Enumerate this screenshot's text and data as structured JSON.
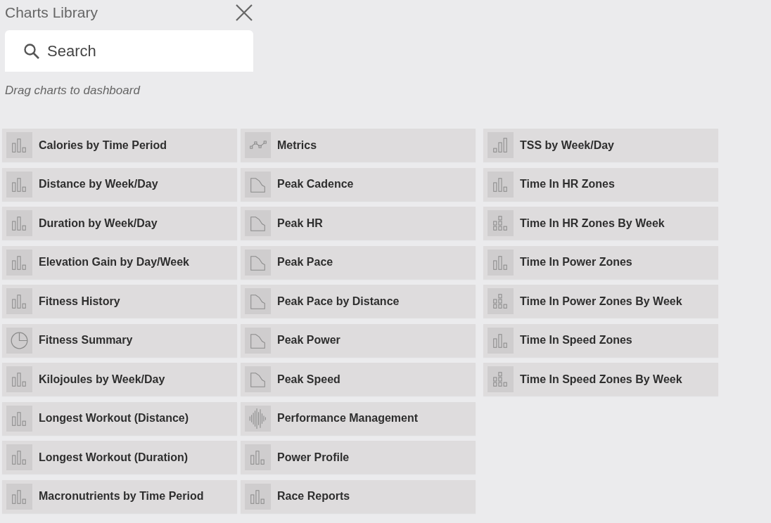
{
  "panel": {
    "title": "Charts Library"
  },
  "search": {
    "placeholder": "Search"
  },
  "hint": "Drag charts to dashboard",
  "columns": [
    [
      {
        "label": "Calories by Time Period",
        "kind": "bar"
      },
      {
        "label": "Distance by Week/Day",
        "kind": "bar"
      },
      {
        "label": "Duration by Week/Day",
        "kind": "bar"
      },
      {
        "label": "Elevation Gain by Day/Week",
        "kind": "bar"
      },
      {
        "label": "Fitness History",
        "kind": "bar"
      },
      {
        "label": "Fitness Summary",
        "kind": "pie"
      },
      {
        "label": "Kilojoules by Week/Day",
        "kind": "bar"
      },
      {
        "label": "Longest Workout (Distance)",
        "kind": "bar"
      },
      {
        "label": "Longest Workout (Duration)",
        "kind": "bar"
      },
      {
        "label": "Macronutrients by Time Period",
        "kind": "bar"
      }
    ],
    [
      {
        "label": "Metrics",
        "kind": "scatter"
      },
      {
        "label": "Peak Cadence",
        "kind": "area"
      },
      {
        "label": "Peak HR",
        "kind": "area"
      },
      {
        "label": "Peak Pace",
        "kind": "area"
      },
      {
        "label": "Peak Pace by Distance",
        "kind": "area"
      },
      {
        "label": "Peak Power",
        "kind": "area"
      },
      {
        "label": "Peak Speed",
        "kind": "area"
      },
      {
        "label": "Performance Management",
        "kind": "wave"
      },
      {
        "label": "Power Profile",
        "kind": "bar"
      },
      {
        "label": "Race Reports",
        "kind": "bar"
      }
    ],
    [
      {
        "label": "TSS by Week/Day",
        "kind": "rising"
      },
      {
        "label": "Time In HR Zones",
        "kind": "bar"
      },
      {
        "label": "Time In HR Zones By Week",
        "kind": "stacked"
      },
      {
        "label": "Time In Power Zones",
        "kind": "bar"
      },
      {
        "label": "Time In Power Zones By Week",
        "kind": "stacked"
      },
      {
        "label": "Time In Speed Zones",
        "kind": "bar"
      },
      {
        "label": "Time In Speed Zones By Week",
        "kind": "stacked"
      }
    ]
  ]
}
